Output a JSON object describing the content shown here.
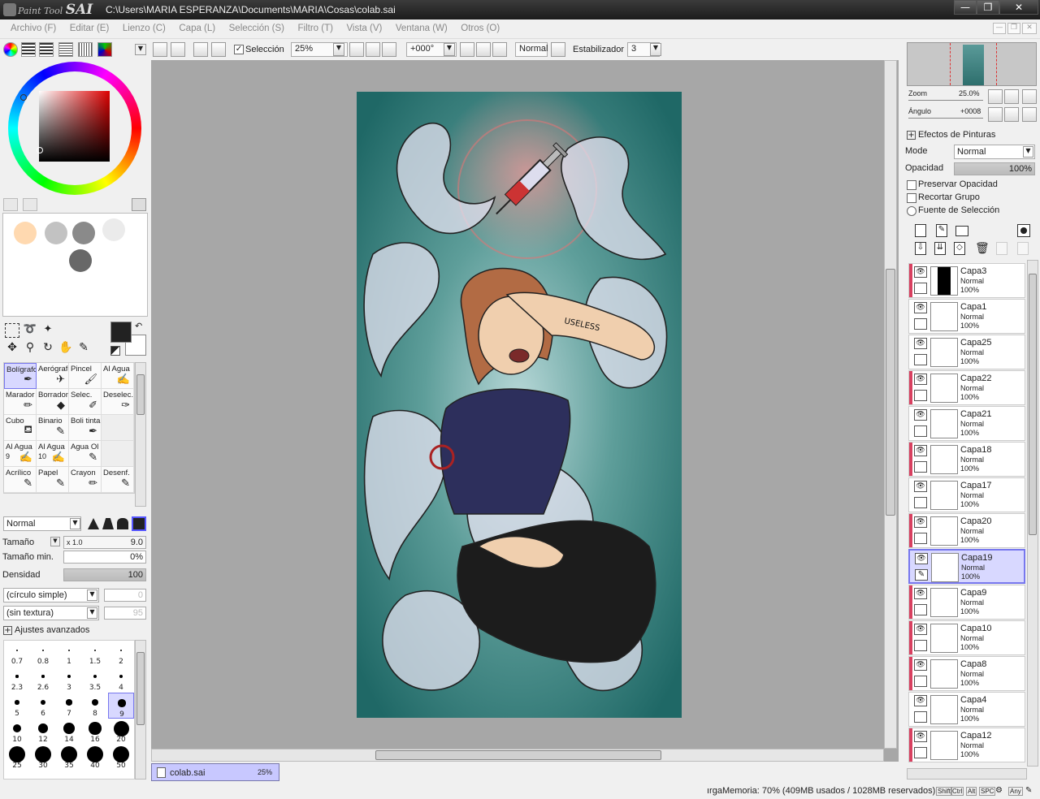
{
  "titlebar": {
    "logo_small": "Paint Tool",
    "logo_big": "SAI",
    "path": "C:\\Users\\MARIA ESPERANZA\\Documents\\MARIA\\Cosas\\colab.sai",
    "min": "—",
    "max": "❐",
    "close": "✕"
  },
  "menu": [
    "Archivo (F)",
    "Editar (E)",
    "Lienzo (C)",
    "Capa (L)",
    "Selección (S)",
    "Filtro (T)",
    "Vista (V)",
    "Ventana (W)",
    "Otros (O)"
  ],
  "toolbar": {
    "seleccion_label": "Selección",
    "zoom_value": "25%",
    "angle_value": "+000°",
    "mode_value": "Normal",
    "estabilizador_label": "Estabilizador",
    "estabilizador_value": "3"
  },
  "colors": {
    "swatches": [
      "#ffd9b0",
      "#c2c2c2",
      "#8a8a8a",
      "#ebebeb",
      "#686868"
    ],
    "primary": "#222222",
    "secondary": "#ffffff",
    "canvas_bg": "#a7a7a7"
  },
  "tools": [
    {
      "label": "Bolígrafo",
      "icon": "pen-icon"
    },
    {
      "label": "Aerógrafo",
      "icon": "airbrush-icon"
    },
    {
      "label": "Pincel",
      "icon": "brush-icon"
    },
    {
      "label": "Al Agua",
      "icon": "watercolor-icon"
    },
    {
      "label": "Marador",
      "icon": "marker-icon"
    },
    {
      "label": "Borrador",
      "icon": "eraser-icon"
    },
    {
      "label": "Selec.",
      "icon": "select-pen-icon"
    },
    {
      "label": "Deselec.",
      "icon": "deselect-pen-icon"
    },
    {
      "label": "Cubo",
      "icon": "bucket-icon"
    },
    {
      "label": "Binario",
      "icon": "binary-pen-icon"
    },
    {
      "label": "Boli tinta",
      "icon": "ink-pen-icon"
    },
    {
      "label": "",
      "icon": ""
    },
    {
      "label": "Al Agua",
      "sub": "9",
      "icon": "watercolor-icon"
    },
    {
      "label": "Al Agua",
      "sub": "10",
      "icon": "watercolor-icon"
    },
    {
      "label": "Agua Ol",
      "icon": "oil-icon"
    },
    {
      "label": "",
      "icon": ""
    },
    {
      "label": "Acrílico",
      "icon": "acrylic-icon"
    },
    {
      "label": "Papel",
      "icon": "paper-icon"
    },
    {
      "label": "Crayon",
      "icon": "crayon-icon"
    },
    {
      "label": "Desenf.",
      "icon": "blur-icon"
    }
  ],
  "brush": {
    "mode": "Normal",
    "tamano_label": "Tamaño",
    "tamano_mult": "x 1.0",
    "tamano_value": "9.0",
    "tamano_min_label": "Tamaño min.",
    "tamano_min_value": "0%",
    "densidad_label": "Densidad",
    "densidad_value": "100",
    "shape": "(círculo simple)",
    "shape_value": "0",
    "texture": "(sin textura)",
    "texture_value": "95",
    "advanced": "Ajustes avanzados"
  },
  "brush_sizes": [
    "0.7",
    "0.8",
    "1",
    "1.5",
    "2",
    "2.3",
    "2.6",
    "3",
    "3.5",
    "4",
    "5",
    "6",
    "7",
    "8",
    "9",
    "10",
    "12",
    "14",
    "16",
    "20",
    "25",
    "30",
    "35",
    "40",
    "50"
  ],
  "navigator": {
    "zoom_label": "Zoom",
    "zoom_value": "25.0%",
    "angle_label": "Ángulo",
    "angle_value": "+0008"
  },
  "layer_panel": {
    "effects_label": "Efectos de Pinturas",
    "mode_label": "Mode",
    "mode_value": "Normal",
    "opacity_label": "Opacidad",
    "opacity_value": "100%",
    "preserve_label": "Preservar Opacidad",
    "clip_label": "Recortar Grupo",
    "source_label": "Fuente de Selección"
  },
  "layers": [
    {
      "name": "Capa3",
      "mode": "Normal",
      "opacity": "100%",
      "red": true,
      "selected": false
    },
    {
      "name": "Capa1",
      "mode": "Normal",
      "opacity": "100%",
      "red": false,
      "selected": false
    },
    {
      "name": "Capa25",
      "mode": "Normal",
      "opacity": "100%",
      "red": false,
      "selected": false
    },
    {
      "name": "Capa22",
      "mode": "Normal",
      "opacity": "100%",
      "red": true,
      "selected": false
    },
    {
      "name": "Capa21",
      "mode": "Normal",
      "opacity": "100%",
      "red": false,
      "selected": false
    },
    {
      "name": "Capa18",
      "mode": "Normal",
      "opacity": "100%",
      "red": true,
      "selected": false
    },
    {
      "name": "Capa17",
      "mode": "Normal",
      "opacity": "100%",
      "red": false,
      "selected": false
    },
    {
      "name": "Capa20",
      "mode": "Normal",
      "opacity": "100%",
      "red": true,
      "selected": false
    },
    {
      "name": "Capa19",
      "mode": "Normal",
      "opacity": "100%",
      "red": false,
      "selected": true
    },
    {
      "name": "Capa9",
      "mode": "Normal",
      "opacity": "100%",
      "red": true,
      "selected": false
    },
    {
      "name": "Capa10",
      "mode": "Normal",
      "opacity": "100%",
      "red": true,
      "selected": false
    },
    {
      "name": "Capa8",
      "mode": "Normal",
      "opacity": "100%",
      "red": true,
      "selected": false
    },
    {
      "name": "Capa4",
      "mode": "Normal",
      "opacity": "100%",
      "red": false,
      "selected": false
    },
    {
      "name": "Capa12",
      "mode": "Normal",
      "opacity": "100%",
      "red": true,
      "selected": false
    }
  ],
  "tab": {
    "name": "colab.sai",
    "zoom": "25%"
  },
  "status": {
    "memory": "ırgaMemoria: 70% (409MB usados / 1028MB reservados)",
    "keys": [
      "Shift",
      "Ctrl",
      "Alt",
      "SPC",
      "Any"
    ]
  },
  "art_text": "USELESS"
}
